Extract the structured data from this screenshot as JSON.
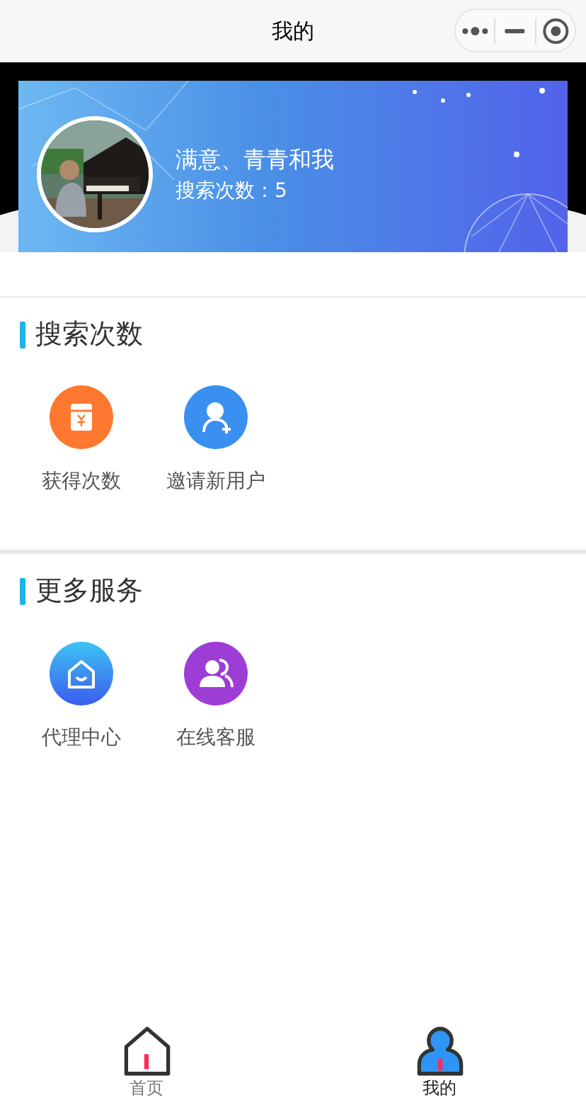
{
  "nav": {
    "title": "我的"
  },
  "profile": {
    "name": "满意、青青和我",
    "search_count": "搜索次数：5"
  },
  "sections": [
    {
      "title": "搜索次数",
      "items": [
        {
          "label": "获得次数",
          "kind": "coupon"
        },
        {
          "label": "邀请新用户",
          "kind": "invite"
        }
      ]
    },
    {
      "title": "更多服务",
      "items": [
        {
          "label": "代理中心",
          "kind": "agent"
        },
        {
          "label": "在线客服",
          "kind": "service"
        }
      ]
    }
  ],
  "tab_bar": [
    {
      "label": "首页",
      "kind": "home",
      "selected": false
    },
    {
      "label": "我的",
      "kind": "profile",
      "selected": true
    }
  ]
}
